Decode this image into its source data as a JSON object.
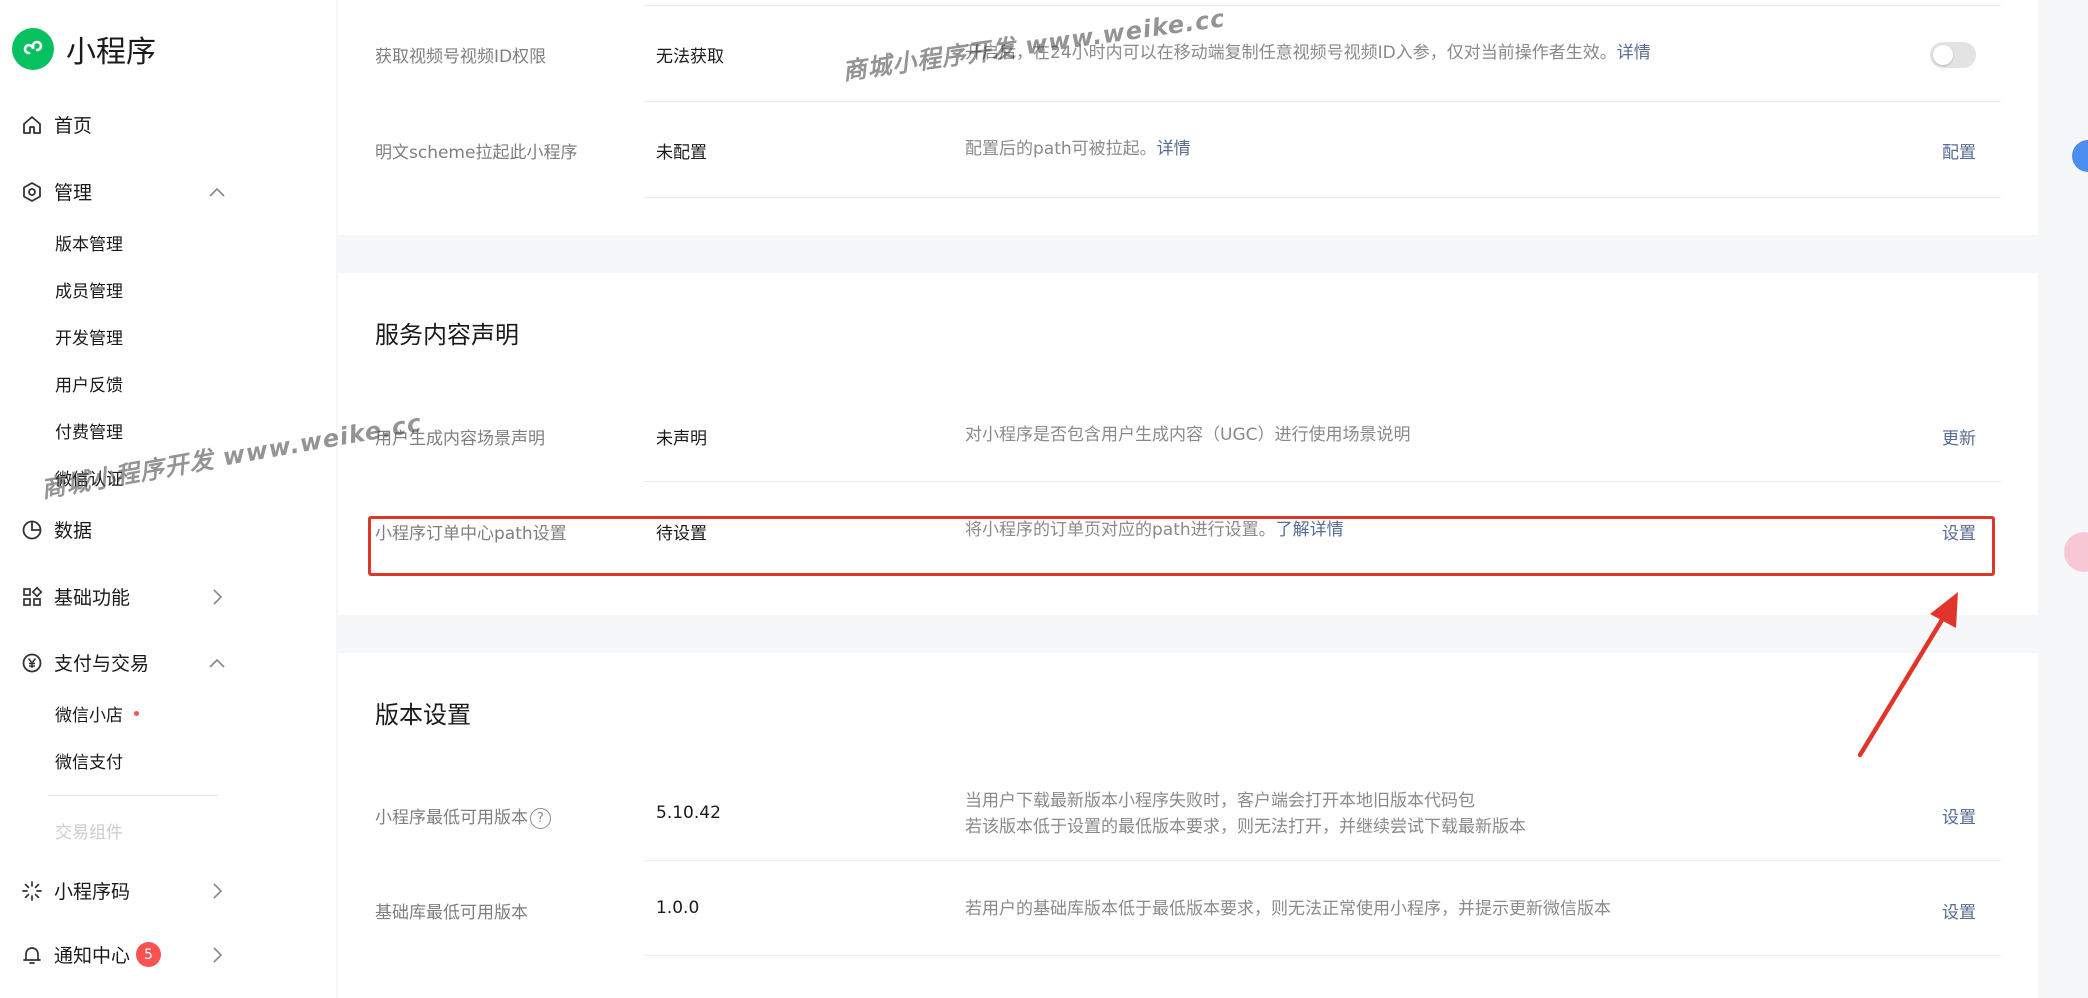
{
  "app": {
    "name": "小程序"
  },
  "sidebar": {
    "home": "首页",
    "manage": "管理",
    "manage_items": [
      "版本管理",
      "成员管理",
      "开发管理",
      "用户反馈",
      "付费管理",
      "微信认证"
    ],
    "data": "数据",
    "basic": "基础功能",
    "pay": "支付与交易",
    "pay_items": [
      "微信小店",
      "微信支付"
    ],
    "pay_faded": "交易组件",
    "qrcode": "小程序码",
    "notice": "通知中心",
    "notice_badge": "5"
  },
  "top_card": {
    "rows": [
      {
        "label": "获取视频号视频ID权限",
        "value": "无法获取",
        "desc": "开启后，在24小时内可以在移动端复制任意视频号视频ID入参，仅对当前操作者生效。",
        "link": "详情",
        "toggle": "off"
      },
      {
        "label": "明文scheme拉起此小程序",
        "value": "未配置",
        "desc": "配置后的path可被拉起。",
        "link": "详情",
        "action": "配置"
      }
    ]
  },
  "service_card": {
    "title": "服务内容声明",
    "rows": [
      {
        "label": "用户生成内容场景声明",
        "value": "未声明",
        "desc": "对小程序是否包含用户生成内容（UGC）进行使用场景说明",
        "action": "更新"
      },
      {
        "label": "小程序订单中心path设置",
        "value": "待设置",
        "desc": "将小程序的订单页对应的path进行设置。",
        "link": "了解详情",
        "action": "设置"
      }
    ]
  },
  "version_card": {
    "title": "版本设置",
    "rows": [
      {
        "label": "小程序最低可用版本",
        "help": "?",
        "value": "5.10.42",
        "desc1": "当用户下载最新版本小程序失败时，客户端会打开本地旧版本代码包",
        "desc2": "若该版本低于设置的最低版本要求，则无法打开，并继续尝试下载最新版本",
        "action": "设置"
      },
      {
        "label": "基础库最低可用版本",
        "value": "1.0.0",
        "desc": "若用户的基础库版本低于最低版本要求，则无法正常使用小程序，并提示更新微信版本",
        "action": "设置"
      }
    ]
  },
  "watermarks": {
    "top": "商城小程序开发  www.weike.cc",
    "left": "商城小程序开发  www.weike.cc"
  },
  "colors": {
    "accent": "#576b95",
    "brand": "#07c160",
    "highlight": "#e0352b",
    "badge": "#fa5151"
  }
}
